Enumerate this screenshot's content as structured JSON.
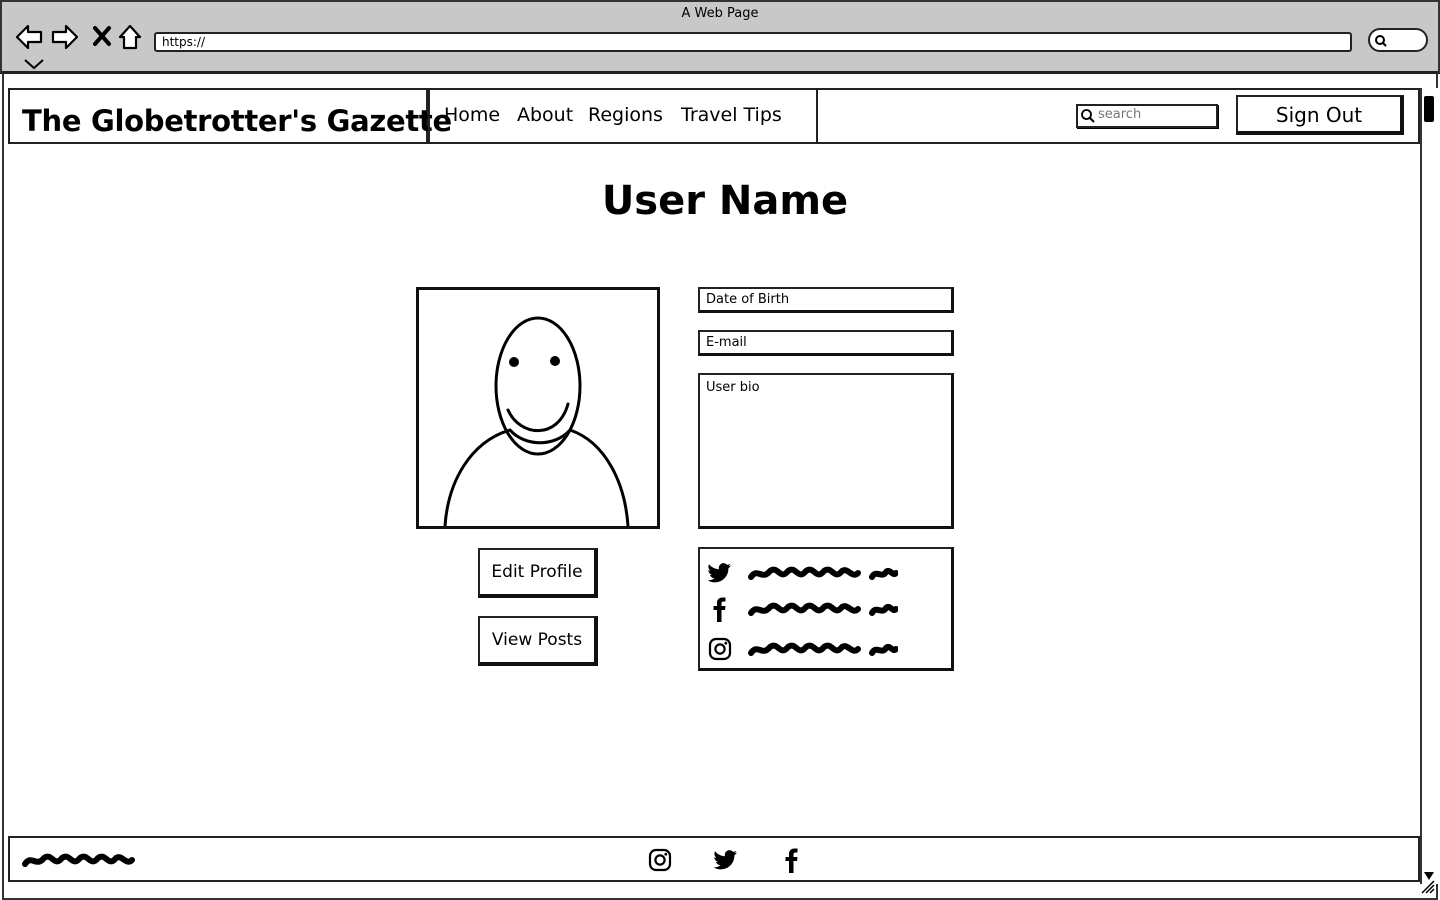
{
  "browser": {
    "window_title": "A Web Page",
    "url": "https://",
    "back_icon": "back-arrow-icon",
    "forward_icon": "forward-arrow-icon",
    "stop_icon": "close-icon",
    "home_icon": "home-icon"
  },
  "header": {
    "brand": "The Globetrotter's Gazette",
    "nav": [
      "Home",
      "About",
      "Regions",
      "Travel Tips"
    ],
    "search_placeholder": "search",
    "sign_out": "Sign Out"
  },
  "profile": {
    "title": "User Name",
    "date_of_birth_placeholder": "Date of Birth",
    "email_placeholder": "E-mail",
    "bio_placeholder": "User bio",
    "edit_profile": "Edit Profile",
    "view_posts": "View Posts",
    "social_icons": [
      "twitter-icon",
      "facebook-icon",
      "instagram-icon"
    ]
  },
  "footer": {
    "social_icons": [
      "instagram-icon",
      "twitter-icon",
      "facebook-icon"
    ]
  },
  "colors": {
    "chrome": "#c8c8c8",
    "ink": "#000000",
    "background": "#ffffff"
  }
}
